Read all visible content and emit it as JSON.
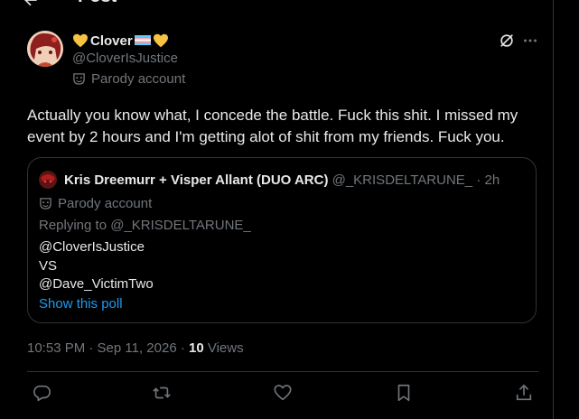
{
  "header": {
    "title": "Post"
  },
  "tweet": {
    "display_name": "Clover",
    "handle": "@CloverIsJustice",
    "parody_label": "Parody account",
    "text": "Actually you know what, I concede the battle. Fuck this shit.  I missed my event by 2 hours and I'm getting alot of shit from my friends. Fuck you."
  },
  "quote": {
    "display_name": "Kris Dreemurr + Visper Allant (DUO ARC)",
    "handle_time": "@_KRISDELTARUNE_ · 2h",
    "parody_label": "Parody account",
    "replying_to": "Replying to @_KRISDELTARUNE_",
    "body_line1": "@CloverIsJustice",
    "body_line2": "VS",
    "body_line3": "@Dave_VictimTwo",
    "poll_link": "Show this poll"
  },
  "meta": {
    "timestamp": "10:53 PM · Sep 11, 2026 · ",
    "views_count": "10",
    "views_label": " Views"
  },
  "colors": {
    "background": "#000000",
    "text": "#e7e9ea",
    "muted": "#71767b",
    "link": "#1d9bf0",
    "border": "#2f3336",
    "heart_yellow": "#f6c342"
  },
  "icons": [
    "back-arrow-icon",
    "yellow-heart-icon",
    "transgender-flag-icon",
    "parody-mask-icon",
    "grok-icon",
    "more-icon",
    "reply-icon",
    "repost-icon",
    "like-icon",
    "bookmark-icon",
    "share-icon"
  ]
}
